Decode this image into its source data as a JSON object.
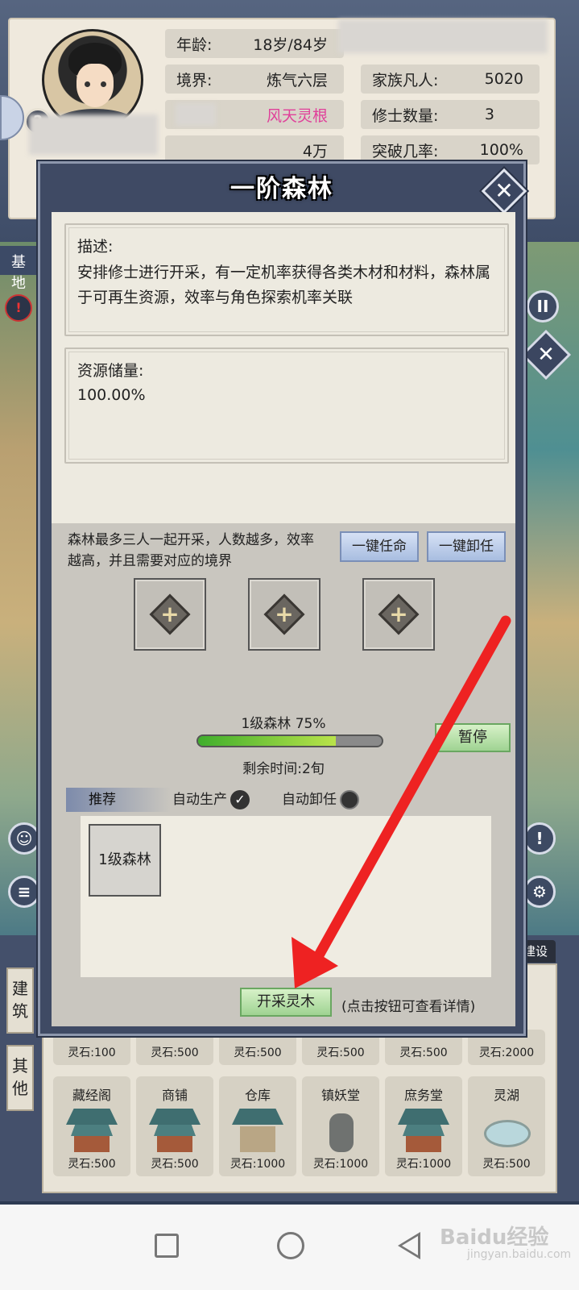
{
  "status": {
    "age_label": "年龄:",
    "age_value": "18岁/84岁",
    "realm_label": "境界:",
    "realm_value": "炼气六层",
    "root_value": "风天灵根",
    "stone_value": "4万",
    "family_label": "家族凡人:",
    "family_value": "5020",
    "cultivators_label": "修士数量:",
    "cultivators_value": "3",
    "breakthrough_label": "突破几率:",
    "breakthrough_value": "100%"
  },
  "map": {
    "base_tab": "基地"
  },
  "modal": {
    "title": "一阶森林",
    "description_label": "描述:",
    "description_text": "安排修士进行开采，有一定机率获得各类木材和材料，森林属于可再生资源，效率与角色探索机率关联",
    "reserve_label": "资源储量:",
    "reserve_value": "100.00%",
    "hint_text": "森林最多三人一起开采，人数越多，效率越高，并且需要对应的境界",
    "appoint_all_button": "一键任命",
    "dismiss_all_button": "一键卸任",
    "slots": [
      "+",
      "+",
      "+"
    ],
    "progress_label": "1级森林 75%",
    "progress": 0.75,
    "remaining_time": "剩余时间:2旬",
    "pause_button": "暂停",
    "recommend_tab": "推荐",
    "auto_produce_label": "自动生产",
    "auto_produce_checked": true,
    "auto_dismiss_label": "自动卸任",
    "auto_dismiss_checked": false,
    "recommend_item": "1级森林",
    "mine_button": "开采灵木",
    "mine_hint": "(点击按钮可查看详情)"
  },
  "side_tabs": {
    "build": "建筑",
    "other": "其他"
  },
  "build_tab": "建设",
  "buildings_row1_costs": [
    "灵石:100",
    "灵石:500",
    "灵石:500",
    "灵石:500",
    "灵石:500",
    "灵石:2000"
  ],
  "buildings_row2": [
    {
      "name": "藏经阁",
      "cost": "灵石:500"
    },
    {
      "name": "商铺",
      "cost": "灵石:500"
    },
    {
      "name": "仓库",
      "cost": "灵石:1000"
    },
    {
      "name": "镇妖堂",
      "cost": "灵石:1000"
    },
    {
      "name": "庶务堂",
      "cost": "灵石:1000"
    },
    {
      "name": "灵湖",
      "cost": "灵石:500"
    }
  ],
  "watermark": {
    "brand": "Baidu经验",
    "url": "jingyan.baidu.com"
  },
  "colors": {
    "root_text": "#e0409a",
    "arrow": "#ee2222",
    "progress_fill": "#8ed63a"
  }
}
